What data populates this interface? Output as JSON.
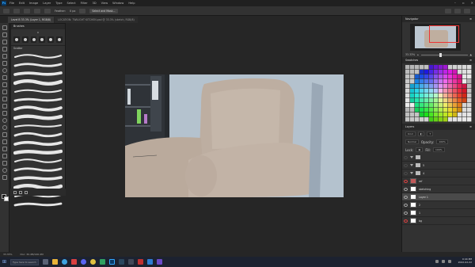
{
  "app": {
    "logo": "Ps"
  },
  "menu": [
    "File",
    "Edit",
    "Image",
    "Layer",
    "Type",
    "Select",
    "Filter",
    "3D",
    "View",
    "Window",
    "Help"
  ],
  "options_bar": {
    "feather_label": "Feather:",
    "feather_value": "0 px",
    "button": "Select and Mask..."
  },
  "tabs": [
    {
      "label": "Level B 33.3% (Layer 1, RGB/8)",
      "active": true
    },
    {
      "label": "LOCATION: TWILIGHT KITCHEN.psd @ 33.3% (sketch, RGB/8)",
      "active": false
    }
  ],
  "brushes_panel": {
    "title": "Brushes",
    "size_value": "o",
    "group_label": "Scatter",
    "tip_icons": [
      "round-hard",
      "round-soft",
      "round-hard",
      "round-soft",
      "round-hard",
      "round-soft"
    ]
  },
  "navigator": {
    "title": "Navigator",
    "zoom": "33.33%"
  },
  "swatches": {
    "title": "Swatches"
  },
  "layers": {
    "title": "Layers",
    "kind_filter": "Kind",
    "blend_mode": "Normal",
    "opacity_label": "Opacity:",
    "opacity_value": "100%",
    "lock_label": "Lock:",
    "fill_label": "Fill:",
    "fill_value": "100%",
    "items": [
      {
        "name": "",
        "type": "folder",
        "visible": false
      },
      {
        "name": "5",
        "type": "folder",
        "visible": false
      },
      {
        "name": "4",
        "type": "folder",
        "visible": false
      },
      {
        "name": "ref",
        "type": "image",
        "visible": true
      },
      {
        "name": "sketching",
        "type": "layer",
        "visible": true
      },
      {
        "name": "Layer 1",
        "type": "layer",
        "visible": true,
        "selected": true
      },
      {
        "name": "2",
        "type": "layer",
        "visible": true
      },
      {
        "name": "1",
        "type": "layer",
        "visible": true
      },
      {
        "name": "bg",
        "type": "layer",
        "visible": true
      }
    ]
  },
  "status": {
    "zoom": "33.33%",
    "doc": "Doc: 30.4M/140.4M"
  },
  "taskbar": {
    "search_placeholder": "Type here to search",
    "time": "9:44 PM",
    "date": "2022-02-22"
  },
  "colors": {
    "accent": "#31a8ff",
    "panel": "#323232",
    "chair": "#bfae9f",
    "wall": "#aebcc8"
  }
}
